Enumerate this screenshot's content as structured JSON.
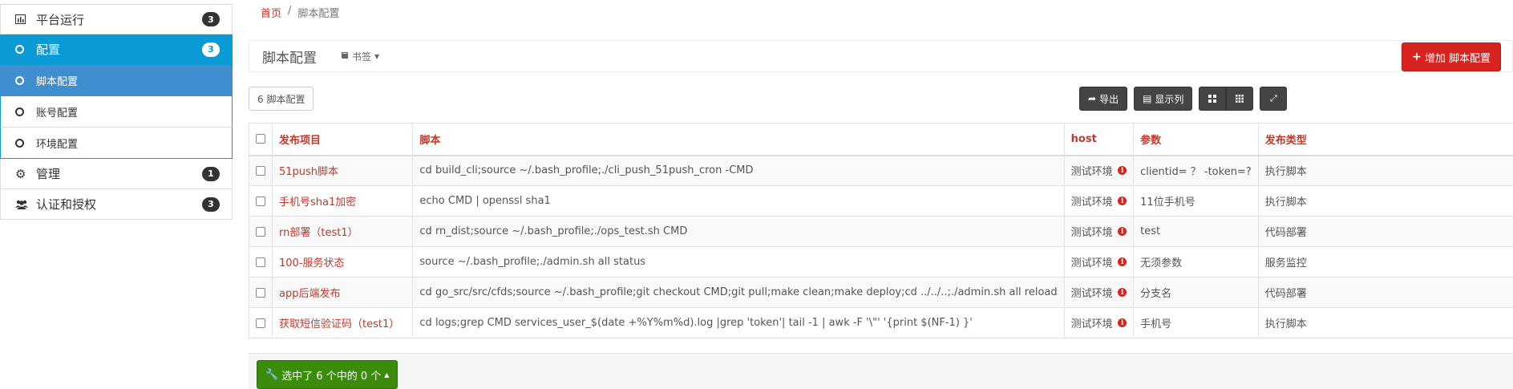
{
  "sidebar": {
    "items": [
      {
        "label": "平台运行",
        "badge": "3",
        "icon": "bar-chart-icon"
      },
      {
        "label": "配置",
        "badge": "3",
        "icon": "circle-icon"
      },
      {
        "label": "脚本配置",
        "icon": "circle-icon"
      },
      {
        "label": "账号配置",
        "icon": "circle-icon"
      },
      {
        "label": "环境配置",
        "icon": "circle-icon"
      },
      {
        "label": "管理",
        "badge": "1",
        "icon": "gear-icon"
      },
      {
        "label": "认证和授权",
        "badge": "3",
        "icon": "users-icon"
      }
    ]
  },
  "breadcrumb": {
    "home": "首页",
    "sep": "/",
    "current": "脚本配置"
  },
  "header": {
    "title": "脚本配置",
    "bookmark": "书签",
    "add_button": "增加 脚本配置"
  },
  "count_label": "6 脚本配置",
  "toolbar": {
    "export": "导出",
    "columns": "显示列"
  },
  "table": {
    "headers": [
      "发布项目",
      "脚本",
      "host",
      "参数",
      "发布类型"
    ],
    "rows": [
      {
        "name": "51push脚本",
        "script": "cd build_cli;source ~/.bash_profile;./cli_push_51push_cron -CMD",
        "host": "测试环境",
        "params": "clientid= ？ -token=?",
        "type": "执行脚本"
      },
      {
        "name": "手机号sha1加密",
        "script": "echo CMD | openssl sha1",
        "host": "测试环境",
        "params": "11位手机号",
        "type": "执行脚本"
      },
      {
        "name": "rn部署（test1）",
        "script": "cd rn_dist;source ~/.bash_profile;./ops_test.sh CMD",
        "host": "测试环境",
        "params": "test",
        "type": "代码部署"
      },
      {
        "name": "100-服务状态",
        "script": "source ~/.bash_profile;./admin.sh all status",
        "host": "测试环境",
        "params": "无须参数",
        "type": "服务监控"
      },
      {
        "name": "app后端发布",
        "script": "cd go_src/src/cfds;source ~/.bash_profile;git checkout CMD;git pull;make clean;make deploy;cd ../../..;./admin.sh all reload",
        "host": "测试环境",
        "params": "分支名",
        "type": "代码部署"
      },
      {
        "name": "获取短信验证码（test1）",
        "script": "cd logs;grep CMD services_user_$(date +%Y%m%d).log |grep 'token'| tail -1 | awk -F '\\\"' '{print $(NF-1) }'",
        "host": "测试环境",
        "params": "手机号",
        "type": "执行脚本"
      }
    ]
  },
  "footer": {
    "selection_button": "选中了 6 个中的 0 个"
  },
  "colors": {
    "accent": "#0a9ad6",
    "danger": "#d9231e",
    "success": "#3c8c0c"
  }
}
